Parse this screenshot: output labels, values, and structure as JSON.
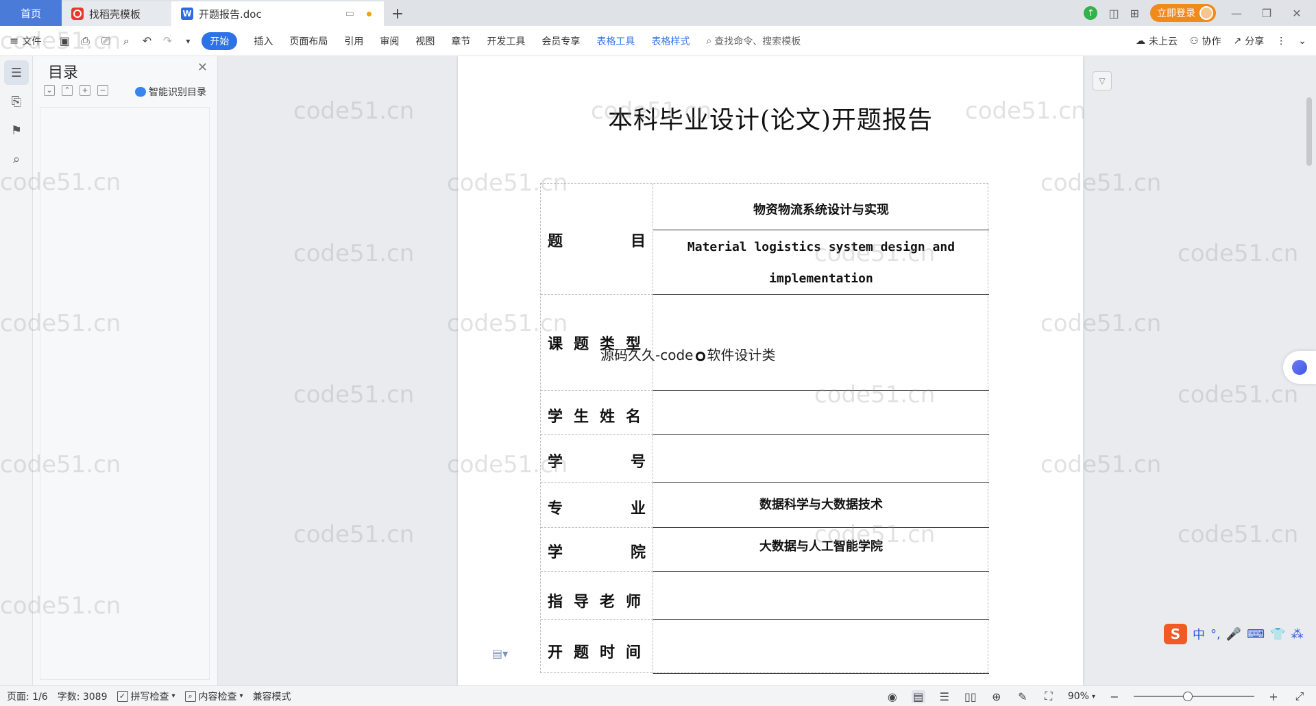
{
  "titlebar": {
    "tabs": [
      {
        "label": "首页"
      },
      {
        "label": "找稻壳模板"
      },
      {
        "label": "开题报告.doc"
      }
    ],
    "login_label": "立即登录"
  },
  "ribbon": {
    "file_label": "文件",
    "menus": [
      "开始",
      "插入",
      "页面布局",
      "引用",
      "审阅",
      "视图",
      "章节",
      "开发工具",
      "会员专享",
      "表格工具",
      "表格样式"
    ],
    "search_placeholder": "查找命令、搜索模板",
    "cloud_label": "未上云",
    "collab_label": "协作",
    "share_label": "分享"
  },
  "nav": {
    "title": "目录",
    "smart_label": "智能识别目录"
  },
  "document": {
    "title": "本科毕业设计(论文)开题报告",
    "rows": [
      {
        "label": "题目",
        "values": [
          "物资物流系统设计与实现",
          "Material logistics system design and",
          "implementation"
        ]
      },
      {
        "label": "课题类型",
        "values": []
      },
      {
        "label": "学生姓名",
        "values": []
      },
      {
        "label": "学号",
        "values": []
      },
      {
        "label": "专业",
        "values": [
          "数据科学与大数据技术"
        ]
      },
      {
        "label": "学院",
        "values": [
          "大数据与人工智能学院"
        ]
      },
      {
        "label": "指导老师",
        "values": []
      },
      {
        "label": "开题时间",
        "values": []
      }
    ],
    "float_note_prefix": "源码久久-code",
    "float_note_suffix": "软件设计类",
    "watermark": "code51.cn"
  },
  "ime": {
    "lang": "中"
  },
  "statusbar": {
    "page": "页面: 1/6",
    "words": "字数: 3089",
    "spell": "拼写检查",
    "content_check": "内容检查",
    "compat": "兼容模式",
    "zoom": "90%"
  }
}
